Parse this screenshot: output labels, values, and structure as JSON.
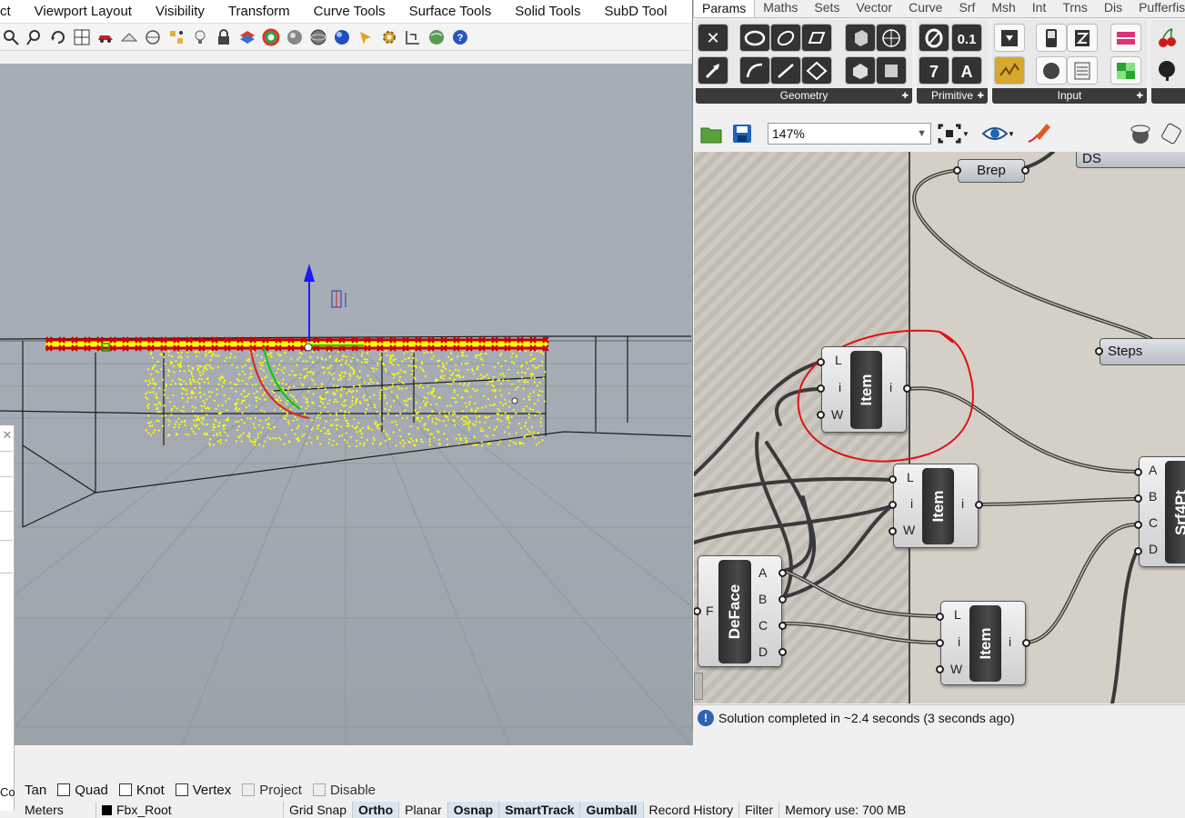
{
  "menu": {
    "items": [
      "ct",
      "Viewport Layout",
      "Visibility",
      "Transform",
      "Curve Tools",
      "Surface Tools",
      "Solid Tools",
      "SubD Tool"
    ]
  },
  "toolbar": {
    "icons": [
      "zoom-extents-icon",
      "zoom-window-icon",
      "rotate-view-icon",
      "grid-icon",
      "car-icon",
      "perspective-icon",
      "target-icon",
      "points-icon",
      "light-bulb-icon",
      "lock-icon",
      "layer-icon",
      "color-wheel-icon",
      "sphere-wire-icon",
      "sphere-shaded-icon",
      "sphere-rendered-icon",
      "paint-icon",
      "gear-icon",
      "dimension-icon",
      "globe-icon",
      "help-icon"
    ]
  },
  "osnap": {
    "items": [
      {
        "label": "Tan",
        "checked": false,
        "has_box": false
      },
      {
        "label": "Quad",
        "checked": false,
        "has_box": true
      },
      {
        "label": "Knot",
        "checked": false,
        "has_box": true
      },
      {
        "label": "Vertex",
        "checked": false,
        "has_box": true
      },
      {
        "label": "Project",
        "checked": false,
        "has_box": true,
        "disabled": true
      },
      {
        "label": "Disable",
        "checked": false,
        "has_box": true,
        "disabled": true
      }
    ]
  },
  "statusbar": {
    "units": "Meters",
    "layer": "Fbx_Root",
    "toggles": [
      {
        "label": "Grid Snap",
        "on": false
      },
      {
        "label": "Ortho",
        "on": true
      },
      {
        "label": "Planar",
        "on": false
      },
      {
        "label": "Osnap",
        "on": true
      },
      {
        "label": "SmartTrack",
        "on": true
      },
      {
        "label": "Gumball",
        "on": true
      },
      {
        "label": "Record History",
        "on": false
      },
      {
        "label": "Filter",
        "on": false
      }
    ],
    "memory": "Memory use: 700 MB"
  },
  "left_panel": {
    "label": "Co"
  },
  "grasshopper": {
    "tabs": [
      "Params",
      "Maths",
      "Sets",
      "Vector",
      "Curve",
      "Srf",
      "Msh",
      "Int",
      "Trns",
      "Dis",
      "Pufferfis"
    ],
    "active_tab": "Params",
    "ribbon_groups": [
      {
        "name": "Geometry"
      },
      {
        "name": "Primitive"
      },
      {
        "name": "Input"
      }
    ],
    "zoom": "147%",
    "status": "Solution completed in ~2.4 seconds (3 seconds ago)",
    "components": {
      "brep": {
        "label": "Brep"
      },
      "ds": {
        "label": "DS"
      },
      "steps": {
        "label": "Steps"
      },
      "item1": {
        "label": "Item",
        "inputs": [
          "L",
          "i",
          "W"
        ],
        "output": "i"
      },
      "item2": {
        "label": "Item",
        "inputs": [
          "L",
          "i",
          "W"
        ],
        "output": "i"
      },
      "item3": {
        "label": "Item",
        "inputs": [
          "L",
          "i",
          "W"
        ],
        "output": "i"
      },
      "deface": {
        "label": "DeFace",
        "input": "F",
        "outputs": [
          "A",
          "B",
          "C",
          "D"
        ]
      },
      "srf4pt": {
        "label": "Srf4Pt",
        "inputs": [
          "A",
          "B",
          "C",
          "D"
        ]
      }
    },
    "annotation_color": "#e01010"
  },
  "colors": {
    "viewport_bg": "#a7adb6",
    "points": "#ffff00",
    "outline": "#cc0000",
    "gumball_z": "#1a1aff",
    "gumball_x": "#00cc00"
  }
}
